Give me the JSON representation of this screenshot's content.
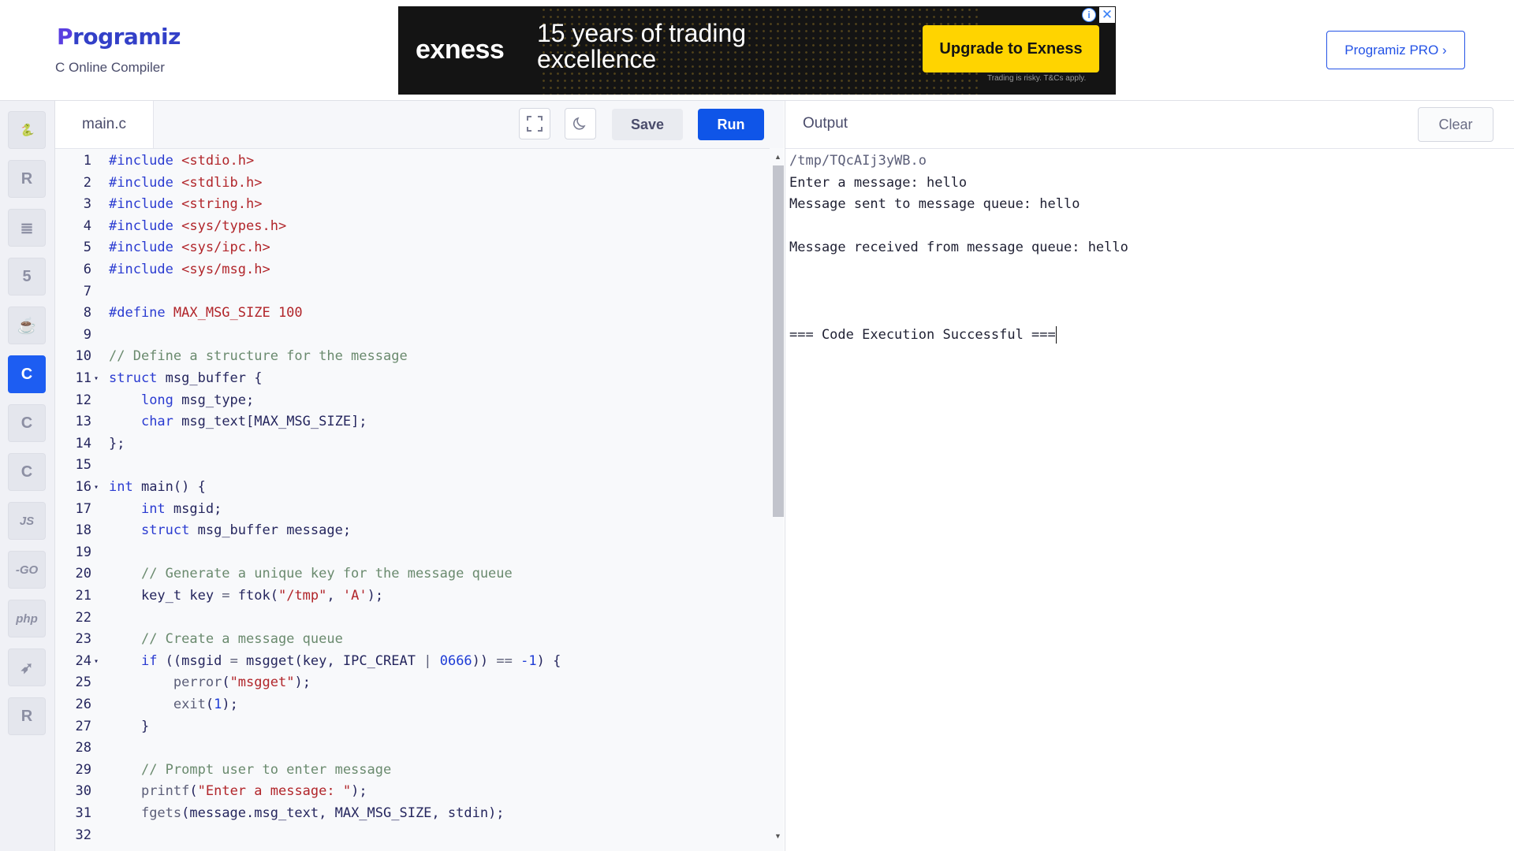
{
  "header": {
    "logo_text": "rogramiz",
    "logo_initial": "P",
    "subtitle": "C Online Compiler",
    "pro_button": "Programiz PRO ›"
  },
  "ad": {
    "brand": "exness",
    "headline": "15 years of trading excellence",
    "cta": "Upgrade to Exness",
    "disclaimer": "Trading is risky. T&Cs apply."
  },
  "sidebar": {
    "items": [
      {
        "name": "python",
        "icon": "python-icon",
        "label": "🐍"
      },
      {
        "name": "r",
        "icon": "r-icon",
        "label": "R"
      },
      {
        "name": "sql",
        "icon": "database-icon",
        "label": "≣"
      },
      {
        "name": "html",
        "icon": "html5-icon",
        "label": "5"
      },
      {
        "name": "java",
        "icon": "java-icon",
        "label": "☕"
      },
      {
        "name": "c",
        "icon": "c-icon",
        "label": "C"
      },
      {
        "name": "cpp",
        "icon": "cpp-icon",
        "label": "C"
      },
      {
        "name": "csharp",
        "icon": "csharp-icon",
        "label": "C"
      },
      {
        "name": "javascript",
        "icon": "js-icon",
        "label": "JS"
      },
      {
        "name": "go",
        "icon": "go-icon",
        "label": "-GO"
      },
      {
        "name": "php",
        "icon": "php-icon",
        "label": "php"
      },
      {
        "name": "swift",
        "icon": "swift-icon",
        "label": "➶"
      },
      {
        "name": "rust",
        "icon": "rust-icon",
        "label": "R"
      }
    ],
    "active": "c"
  },
  "editor": {
    "filename": "main.c",
    "save_label": "Save",
    "run_label": "Run",
    "lines": [
      {
        "n": "1",
        "parts": [
          [
            "k",
            "#include "
          ],
          [
            "s",
            "<stdio.h>"
          ]
        ]
      },
      {
        "n": "2",
        "parts": [
          [
            "k",
            "#include "
          ],
          [
            "s",
            "<stdlib.h>"
          ]
        ]
      },
      {
        "n": "3",
        "parts": [
          [
            "k",
            "#include "
          ],
          [
            "s",
            "<string.h>"
          ]
        ]
      },
      {
        "n": "4",
        "parts": [
          [
            "k",
            "#include "
          ],
          [
            "s",
            "<sys/types.h>"
          ]
        ]
      },
      {
        "n": "5",
        "parts": [
          [
            "k",
            "#include "
          ],
          [
            "s",
            "<sys/ipc.h>"
          ]
        ]
      },
      {
        "n": "6",
        "parts": [
          [
            "k",
            "#include "
          ],
          [
            "s",
            "<sys/msg.h>"
          ]
        ]
      },
      {
        "n": "7",
        "parts": []
      },
      {
        "n": "8",
        "parts": [
          [
            "k",
            "#define "
          ],
          [
            "s",
            "MAX_MSG_SIZE 100"
          ]
        ]
      },
      {
        "n": "9",
        "parts": []
      },
      {
        "n": "10",
        "parts": [
          [
            "c",
            "// Define a structure for the message"
          ]
        ]
      },
      {
        "n": "11",
        "fold": true,
        "parts": [
          [
            "k",
            "struct"
          ],
          [
            "t",
            " msg_buffer {"
          ]
        ]
      },
      {
        "n": "12",
        "parts": [
          [
            "t",
            "    "
          ],
          [
            "k",
            "long"
          ],
          [
            "t",
            " msg_type;"
          ]
        ]
      },
      {
        "n": "13",
        "parts": [
          [
            "t",
            "    "
          ],
          [
            "k",
            "char"
          ],
          [
            "t",
            " msg_text[MAX_MSG_SIZE];"
          ]
        ]
      },
      {
        "n": "14",
        "parts": [
          [
            "t",
            "};"
          ]
        ]
      },
      {
        "n": "15",
        "parts": []
      },
      {
        "n": "16",
        "fold": true,
        "parts": [
          [
            "k",
            "int"
          ],
          [
            "t",
            " main() {"
          ]
        ]
      },
      {
        "n": "17",
        "parts": [
          [
            "t",
            "    "
          ],
          [
            "k",
            "int"
          ],
          [
            "t",
            " msgid;"
          ]
        ]
      },
      {
        "n": "18",
        "parts": [
          [
            "t",
            "    "
          ],
          [
            "k",
            "struct"
          ],
          [
            "t",
            " msg_buffer message;"
          ]
        ]
      },
      {
        "n": "19",
        "parts": []
      },
      {
        "n": "20",
        "parts": [
          [
            "t",
            "    "
          ],
          [
            "c",
            "// Generate a unique key for the message queue"
          ]
        ]
      },
      {
        "n": "21",
        "parts": [
          [
            "t",
            "    key_t key "
          ],
          [
            "f",
            "="
          ],
          [
            "t",
            " ftok("
          ],
          [
            "s",
            "\"/tmp\""
          ],
          [
            "t",
            ", "
          ],
          [
            "s",
            "'A'"
          ],
          [
            "t",
            ");"
          ]
        ]
      },
      {
        "n": "22",
        "parts": []
      },
      {
        "n": "23",
        "parts": [
          [
            "t",
            "    "
          ],
          [
            "c",
            "// Create a message queue"
          ]
        ]
      },
      {
        "n": "24",
        "fold": true,
        "parts": [
          [
            "t",
            "    "
          ],
          [
            "k",
            "if"
          ],
          [
            "t",
            " ((msgid "
          ],
          [
            "f",
            "="
          ],
          [
            "t",
            " msgget(key, IPC_CREAT "
          ],
          [
            "f",
            "|"
          ],
          [
            "t",
            " "
          ],
          [
            "n",
            "0666"
          ],
          [
            "t",
            ")) "
          ],
          [
            "f",
            "=="
          ],
          [
            "t",
            " "
          ],
          [
            "n",
            "-1"
          ],
          [
            "t",
            ") {"
          ]
        ]
      },
      {
        "n": "25",
        "parts": [
          [
            "t",
            "        "
          ],
          [
            "f",
            "perror"
          ],
          [
            "t",
            "("
          ],
          [
            "s",
            "\"msgget\""
          ],
          [
            "t",
            ");"
          ]
        ]
      },
      {
        "n": "26",
        "parts": [
          [
            "t",
            "        "
          ],
          [
            "f",
            "exit"
          ],
          [
            "t",
            "("
          ],
          [
            "n",
            "1"
          ],
          [
            "t",
            ");"
          ]
        ]
      },
      {
        "n": "27",
        "parts": [
          [
            "t",
            "    }"
          ]
        ]
      },
      {
        "n": "28",
        "parts": []
      },
      {
        "n": "29",
        "parts": [
          [
            "t",
            "    "
          ],
          [
            "c",
            "// Prompt user to enter message"
          ]
        ]
      },
      {
        "n": "30",
        "parts": [
          [
            "t",
            "    "
          ],
          [
            "f",
            "printf"
          ],
          [
            "t",
            "("
          ],
          [
            "s",
            "\"Enter a message: \""
          ],
          [
            "t",
            ");"
          ]
        ]
      },
      {
        "n": "31",
        "parts": [
          [
            "t",
            "    "
          ],
          [
            "f",
            "fgets"
          ],
          [
            "t",
            "(message.msg_text, MAX_MSG_SIZE, stdin);"
          ]
        ]
      },
      {
        "n": "32",
        "parts": []
      }
    ]
  },
  "output": {
    "title": "Output",
    "clear_label": "Clear",
    "lines": [
      {
        "text": "/tmp/TQcAIj3yWB.o",
        "kind": "path"
      },
      {
        "text": "Enter a message: hello",
        "kind": "out"
      },
      {
        "text": "Message sent to message queue: hello",
        "kind": "out"
      },
      {
        "text": "",
        "kind": "out"
      },
      {
        "text": "Message received from message queue: hello",
        "kind": "out"
      },
      {
        "text": "",
        "kind": "out"
      },
      {
        "text": "",
        "kind": "out"
      },
      {
        "text": "",
        "kind": "out"
      },
      {
        "text": "=== Code Execution Successful ===",
        "kind": "cursor"
      }
    ]
  }
}
